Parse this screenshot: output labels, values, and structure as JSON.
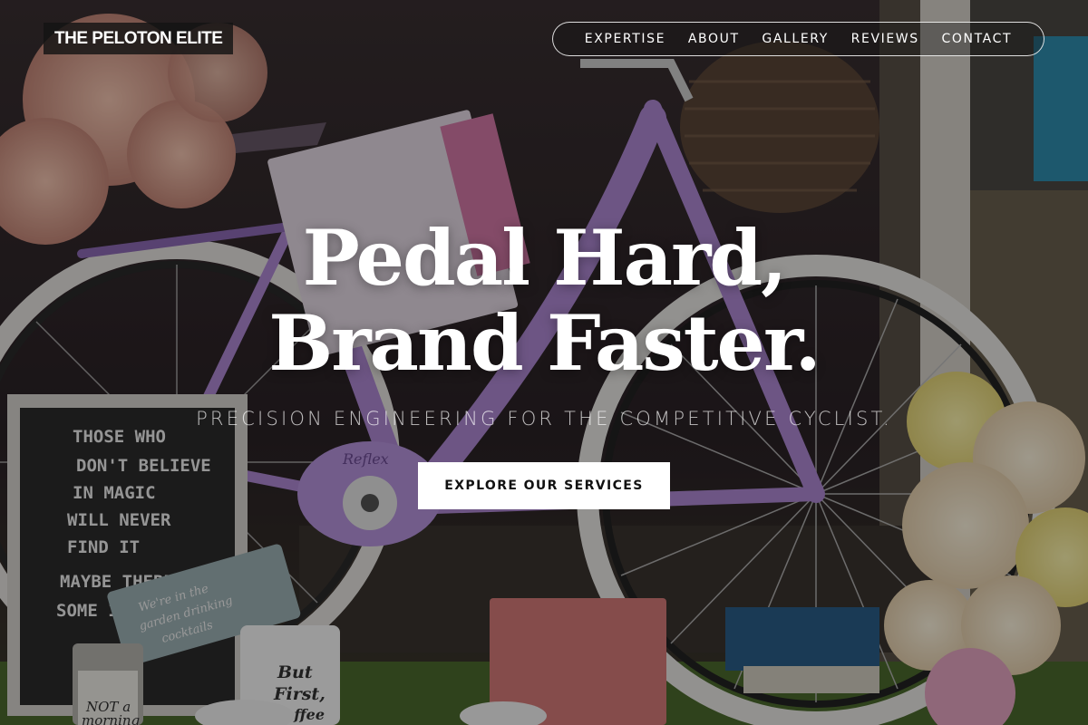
{
  "brand": {
    "logo_text": "THE PELOTON ELITE"
  },
  "nav": {
    "items": [
      {
        "label": "EXPERTISE"
      },
      {
        "label": "ABOUT"
      },
      {
        "label": "GALLERY"
      },
      {
        "label": "REVIEWS"
      },
      {
        "label": "CONTACT"
      }
    ]
  },
  "hero": {
    "headline_line1": "Pedal Hard,",
    "headline_line2": "Brand Faster.",
    "subtitle": "PRECISION ENGINEERING FOR THE COMPETITIVE CYCLIST.",
    "cta_label": "EXPLORE OUR SERVICES",
    "letter_board_lines": [
      "THOSE WHO",
      "DON'T BELIEVE",
      "IN MAGIC",
      "WILL NEVER",
      "FIND IT",
      "MAYBE THERE",
      "SOME IN"
    ],
    "mug_text": [
      "But",
      "First,",
      "coffee"
    ],
    "tumbler_text": [
      "NOT a",
      "morning"
    ],
    "tag_text": [
      "We're in the",
      "garden drinking",
      "cocktails"
    ],
    "chainguard_text": "Reflex"
  },
  "colors": {
    "frame_purple": "#b08ad6",
    "cta_background": "#ffffff",
    "cta_text": "#111111",
    "text_white": "#ffffff"
  }
}
